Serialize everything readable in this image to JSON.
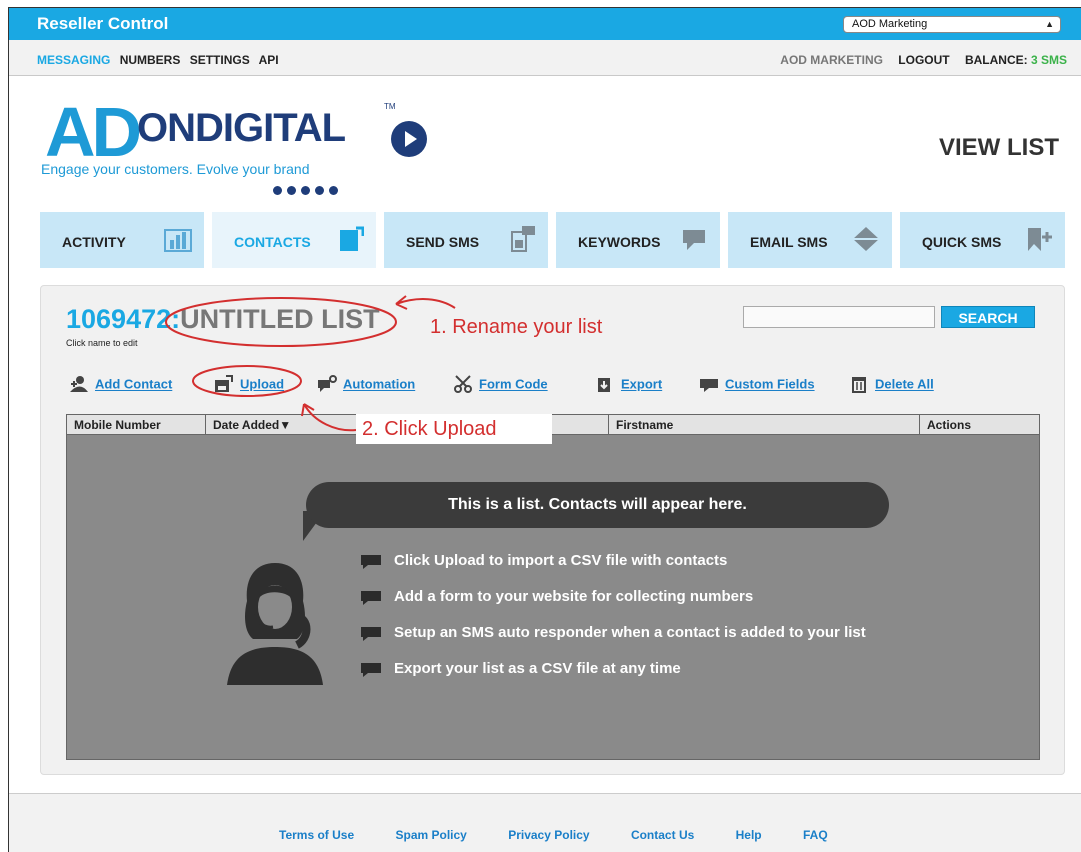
{
  "topbar": {
    "brand": "Reseller Control",
    "account_select": "AOD Marketing"
  },
  "nav": {
    "left": [
      "MESSAGING",
      "NUMBERS",
      "SETTINGS",
      "API"
    ],
    "active": "MESSAGING",
    "account": "AOD MARKETING",
    "logout": "LOGOUT",
    "balance_label": "BALANCE:",
    "balance_value": "3 SMS"
  },
  "logo": {
    "ad": "AD",
    "on_digital": "ONDIGITAL",
    "tm": "TM",
    "tagline": "Engage your customers. Evolve your brand"
  },
  "page_title": "VIEW LIST",
  "tabs": [
    {
      "label": "ACTIVITY",
      "icon": "bar-chart-icon"
    },
    {
      "label": "CONTACTS",
      "icon": "contacts-book-icon"
    },
    {
      "label": "SEND SMS",
      "icon": "phone-message-icon"
    },
    {
      "label": "KEYWORDS",
      "icon": "speech-bubble-icon"
    },
    {
      "label": "EMAIL SMS",
      "icon": "envelope-icon"
    },
    {
      "label": "QUICK SMS",
      "icon": "quick-add-icon"
    }
  ],
  "list": {
    "id": "1069472:",
    "name": "UNTITLED LIST",
    "hint": "Click name to edit"
  },
  "search": {
    "button": "SEARCH",
    "value": ""
  },
  "actions": [
    "Add Contact",
    "Upload",
    "Automation",
    "Form Code",
    "Export",
    "Custom Fields",
    "Delete All"
  ],
  "table": {
    "columns": [
      "Mobile Number",
      "Date Added▼",
      "",
      "Firstname",
      "Actions"
    ]
  },
  "empty_state": {
    "heading": "This is a list. Contacts will appear here.",
    "tips": [
      "Click Upload to import a CSV file with contacts",
      "Add a form to your website for collecting numbers",
      "Setup an SMS auto responder when a contact is added to your list",
      "Export your list as a CSV file at any time"
    ]
  },
  "annotations": {
    "step1": "1. Rename your list",
    "step2": "2. Click Upload"
  },
  "footer": [
    "Terms of Use",
    "Spam Policy",
    "Privacy Policy",
    "Contact Us",
    "Help",
    "FAQ"
  ],
  "colors": {
    "accent": "#1aa8e3",
    "navy": "#1f3d7a",
    "annotation": "#d32f2f",
    "balance": "#3bb24a"
  }
}
